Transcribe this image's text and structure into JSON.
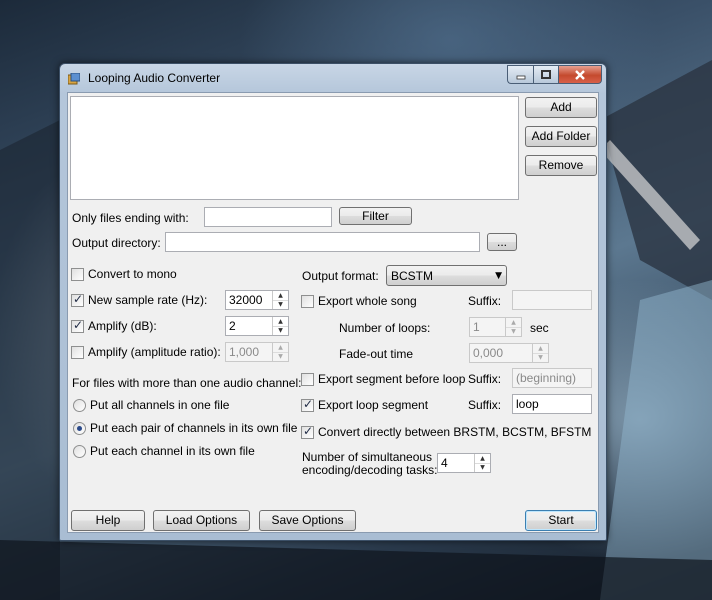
{
  "window": {
    "title": "Looping Audio Converter"
  },
  "buttons": {
    "add": "Add",
    "add_folder": "Add Folder",
    "remove": "Remove",
    "filter": "Filter",
    "browse": "...",
    "help": "Help",
    "load_options": "Load Options",
    "save_options": "Save Options",
    "start": "Start"
  },
  "filter": {
    "label": "Only files ending with:",
    "value": ""
  },
  "output_directory": {
    "label": "Output directory:",
    "value": ""
  },
  "options": {
    "convert_to_mono": {
      "label": "Convert to mono",
      "checked": false
    },
    "new_sample_rate": {
      "label": "New sample rate (Hz):",
      "checked": true,
      "value": "32000"
    },
    "amplify_db": {
      "label": "Amplify (dB):",
      "checked": true,
      "value": "2"
    },
    "amplify_ratio": {
      "label": "Amplify (amplitude ratio):",
      "checked": false,
      "value": "1,000"
    }
  },
  "channels": {
    "heading": "For files with more than one audio channel:",
    "options": [
      {
        "label": "Put all channels in one file",
        "selected": false
      },
      {
        "label": "Put each pair of channels in its own file",
        "selected": true
      },
      {
        "label": "Put each channel in its own file",
        "selected": false
      }
    ]
  },
  "output_format": {
    "label": "Output format:",
    "value": "BCSTM"
  },
  "export_whole_song": {
    "label": "Export whole song",
    "checked": false,
    "suffix_label": "Suffix:",
    "suffix_value": ""
  },
  "number_of_loops": {
    "label": "Number of loops:",
    "value": "1",
    "unit": "sec"
  },
  "fade_out": {
    "label": "Fade-out time",
    "value": "0,000"
  },
  "export_before_loop": {
    "label": "Export segment before loop",
    "checked": false,
    "suffix_label": "Suffix:",
    "suffix_value": "(beginning)"
  },
  "export_loop_segment": {
    "label": "Export loop segment",
    "checked": true,
    "suffix_label": "Suffix:",
    "suffix_value": "loop"
  },
  "convert_directly": {
    "label": "Convert directly between BRSTM, BCSTM, BFSTM",
    "checked": true
  },
  "tasks": {
    "label_line1": "Number of simultaneous",
    "label_line2": "encoding/decoding tasks:",
    "value": "4"
  }
}
